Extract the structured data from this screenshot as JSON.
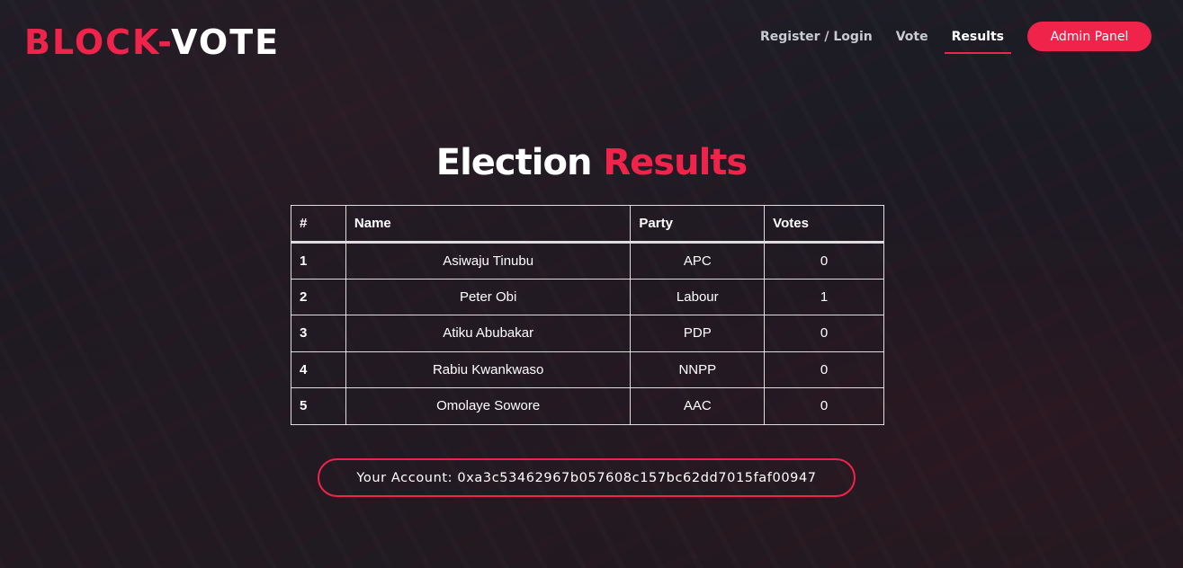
{
  "brand": {
    "part1": "BLOCK-",
    "part2": "VOTE"
  },
  "nav": {
    "links": [
      "Register / Login",
      "Vote",
      "Results"
    ],
    "active": "Results",
    "admin_button": "Admin Panel"
  },
  "title": {
    "part1": "Election",
    "part2": "Results"
  },
  "table": {
    "headers": [
      "#",
      "Name",
      "Party",
      "Votes"
    ],
    "rows": [
      {
        "index": "1",
        "name": "Asiwaju Tinubu",
        "party": "APC",
        "votes": "0"
      },
      {
        "index": "2",
        "name": "Peter Obi",
        "party": "Labour",
        "votes": "1"
      },
      {
        "index": "3",
        "name": "Atiku Abubakar",
        "party": "PDP",
        "votes": "0"
      },
      {
        "index": "4",
        "name": "Rabiu Kwankwaso",
        "party": "NNPP",
        "votes": "0"
      },
      {
        "index": "5",
        "name": "Omolaye Sowore",
        "party": "AAC",
        "votes": "0"
      }
    ]
  },
  "account": {
    "label": "Your Account:",
    "address": "0xa3c53462967b057608c157bc62dd7015faf00947"
  },
  "colors": {
    "accent": "#f0244a",
    "text": "#ffffff",
    "nav_inactive": "#c9cbd3"
  }
}
